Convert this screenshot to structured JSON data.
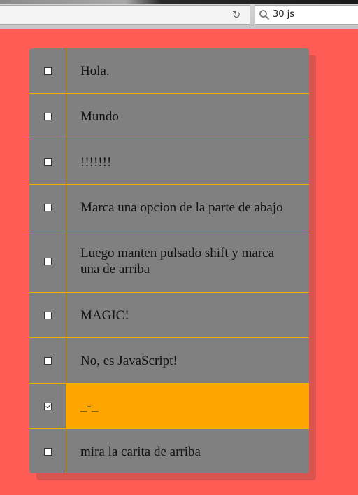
{
  "browser": {
    "search_query": "30 js",
    "reload_icon": "reload-icon",
    "search_icon": "search-icon"
  },
  "colors": {
    "page_background": "#ff5c55",
    "list_background": "#808080",
    "separator": "#f0b200",
    "checked_row": "#ffa600"
  },
  "items": [
    {
      "label": "Hola.",
      "checked": false
    },
    {
      "label": "Mundo",
      "checked": false
    },
    {
      "label": "!!!!!!!",
      "checked": false
    },
    {
      "label": "Marca una opcion de la parte de abajo",
      "checked": false
    },
    {
      "label": "Luego manten pulsado shift y marca una de arriba",
      "checked": false
    },
    {
      "label": "MAGIC!",
      "checked": false
    },
    {
      "label": "No, es JavaScript!",
      "checked": false
    },
    {
      "label": "_-_",
      "checked": true
    },
    {
      "label": "mira la carita de arriba",
      "checked": false
    }
  ]
}
